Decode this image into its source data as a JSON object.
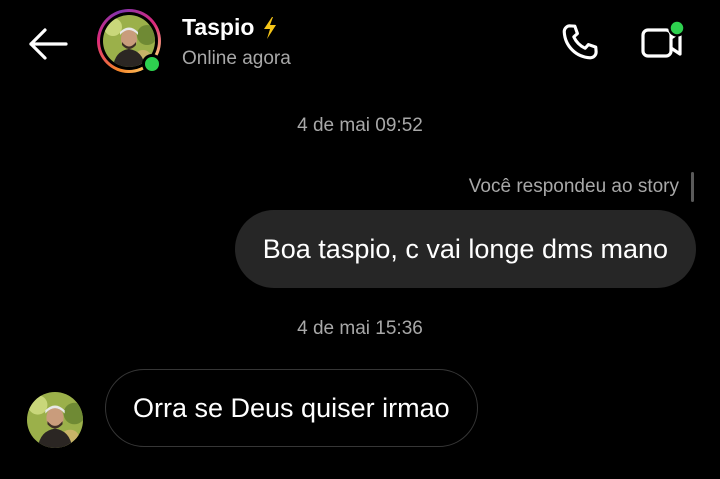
{
  "header": {
    "back_icon": "arrow-left-icon",
    "contact_name": "Taspio",
    "name_badge_icon": "lightning-bolt-icon",
    "status": "Online agora",
    "call_icon": "phone-icon",
    "video_icon": "video-camera-icon"
  },
  "conversation": {
    "date_separators": [
      "4 de mai 09:52",
      "4 de mai 15:36"
    ],
    "story_reply_label": "Você respondeu ao story",
    "messages": [
      {
        "direction": "outgoing",
        "text": "Boa taspio, c vai longe dms mano"
      },
      {
        "direction": "incoming",
        "text": "Orra se Deus quiser irmao"
      }
    ]
  },
  "colors": {
    "background": "#000000",
    "outgoing_bubble": "#262626",
    "incoming_bubble_border": "#363636",
    "secondary_text": "#a8a8a8",
    "online_green": "#2ed14f",
    "bolt_yellow": "#f5c518"
  }
}
